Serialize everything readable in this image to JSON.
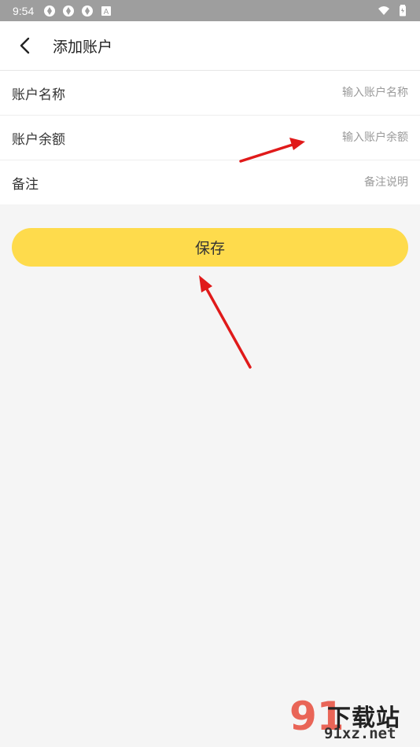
{
  "status_bar": {
    "time": "9:54",
    "icons": [
      "aperture-icon",
      "aperture-icon",
      "aperture-icon",
      "a-badge-icon"
    ],
    "a_badge": "A",
    "right_icons": [
      "wifi-icon",
      "battery-icon"
    ]
  },
  "header": {
    "title": "添加账户",
    "back_icon": "chevron-left-icon"
  },
  "form": {
    "rows": [
      {
        "label": "账户名称",
        "value": "",
        "placeholder": "输入账户名称"
      },
      {
        "label": "账户余额",
        "value": "",
        "placeholder": "输入账户余额"
      },
      {
        "label": "备注",
        "value": "",
        "placeholder": "备注说明"
      }
    ]
  },
  "save_button": {
    "label": "保存"
  },
  "watermark": {
    "logo_number": "91",
    "brand": "下载站",
    "url": "91xz.net"
  },
  "colors": {
    "status_bar": "#9e9e9e",
    "accent": "#fedb4c",
    "background": "#f5f5f5",
    "annotation_arrow": "#e01a1a"
  }
}
